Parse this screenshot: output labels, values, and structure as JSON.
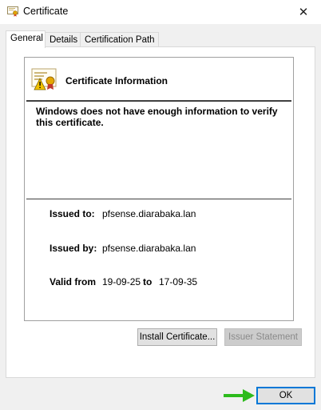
{
  "window": {
    "title": "Certificate",
    "close_glyph": "✕"
  },
  "tabs": [
    {
      "label": "General"
    },
    {
      "label": "Details"
    },
    {
      "label": "Certification Path"
    }
  ],
  "certificate": {
    "heading": "Certificate Information",
    "warning": "Windows does not have enough information to verify this certificate.",
    "issued_to_label": "Issued to:",
    "issued_to": "pfsense.diarabaka.lan",
    "issued_by_label": "Issued by:",
    "issued_by": "pfsense.diarabaka.lan",
    "valid_from_label": "Valid from",
    "valid_from": "19-09-25",
    "to_label": "to",
    "valid_to": "17-09-35"
  },
  "buttons": {
    "install": "Install Certificate...",
    "issuer_statement": "Issuer Statement",
    "ok": "OK"
  },
  "colors": {
    "accent": "#0078d7",
    "arrow": "#2dbb1c"
  }
}
